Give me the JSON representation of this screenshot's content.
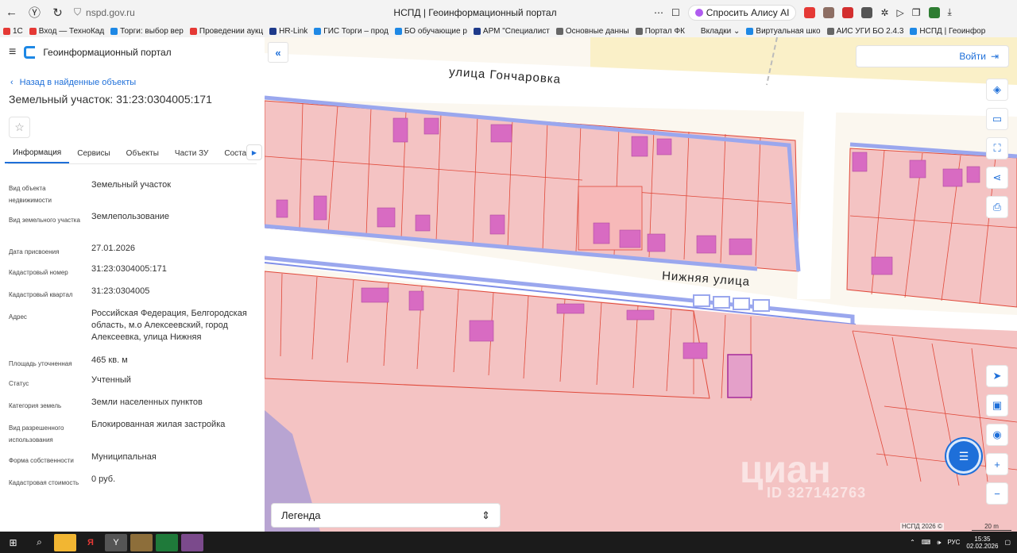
{
  "browser": {
    "address": "nspd.gov.ru",
    "window_title": "НСПД | Геоинформационный портал",
    "alice_label": "Спросить Алису AI",
    "bookmarks": [
      {
        "label": "1С",
        "color": "#e53935"
      },
      {
        "label": "Вход — ТехноКад",
        "color": "#e53935"
      },
      {
        "label": "Торги: выбор вер",
        "color": "#1e88e5"
      },
      {
        "label": "Проведении аукц",
        "color": "#e53935"
      },
      {
        "label": "HR-Link",
        "color": "#1e3a8a"
      },
      {
        "label": "ГИС Торги – прод",
        "color": "#1e88e5"
      },
      {
        "label": "БО обучающие р",
        "color": "#1e88e5"
      },
      {
        "label": "АРМ \"Специалист",
        "color": "#1e3a8a"
      },
      {
        "label": "Основные данны",
        "color": "#666666"
      },
      {
        "label": "Портал ФК",
        "color": "#666666"
      },
      {
        "label": "Вкладки ⌄",
        "color": "#f3f3f3"
      },
      {
        "label": "Виртуальная шко",
        "color": "#1e88e5"
      },
      {
        "label": "АИС УГИ БО 2.4.3",
        "color": "#666666"
      },
      {
        "label": "НСПД | Геоинфор",
        "color": "#1e88e5"
      }
    ]
  },
  "panel": {
    "portal_title": "Геоинформационный портал",
    "back_label": "Назад в найденные объекты",
    "object_title": "Земельный участок: 31:23:0304005:171",
    "tabs": [
      "Информация",
      "Сервисы",
      "Объекты",
      "Части ЗУ",
      "Состав"
    ],
    "properties": [
      {
        "label": "Вид объекта недвижимости",
        "value": "Земельный участок"
      },
      {
        "label": "Вид земельного участка",
        "value": "Землепользование"
      },
      {
        "label": "Дата присвоения",
        "value": "27.01.2026"
      },
      {
        "label": "Кадастровый номер",
        "value": "31:23:0304005:171"
      },
      {
        "label": "Кадастровый квартал",
        "value": "31:23:0304005"
      },
      {
        "label": "Адрес",
        "value": "Российская Федерация, Белгородская область, м.о Алексеевский, город Алексеевка, улица Нижняя"
      },
      {
        "label": "Площадь уточненная",
        "value": "465 кв. м"
      },
      {
        "label": "Статус",
        "value": "Учтенный"
      },
      {
        "label": "Категория земель",
        "value": "Земли населенных пунктов"
      },
      {
        "label": "Вид разрешенного использования",
        "value": "Блокированная жилая застройка"
      },
      {
        "label": "Форма собственности",
        "value": "Муниципальная"
      },
      {
        "label": "Кадастровая стоимость",
        "value": "0 руб."
      }
    ]
  },
  "map": {
    "login_label": "Войти",
    "street_top": "улица Гончаровка",
    "street_mid": "Нижняя улица",
    "legend_label": "Легенда",
    "attribution": "НСПД 2026 ©",
    "scale_label": "20 m",
    "watermark": "циан",
    "watermark_id": "ID 327142763"
  },
  "taskbar": {
    "language": "РУС",
    "time": "15:35",
    "date": "02.02.2026"
  },
  "colors": {
    "accent": "#1e6fd9",
    "parcel_fill": "#f4c3c3",
    "parcel_stroke": "#e0493a",
    "building": "#d86bc2",
    "road_edge": "#9aa7ee",
    "selected": "#d45fb5"
  }
}
